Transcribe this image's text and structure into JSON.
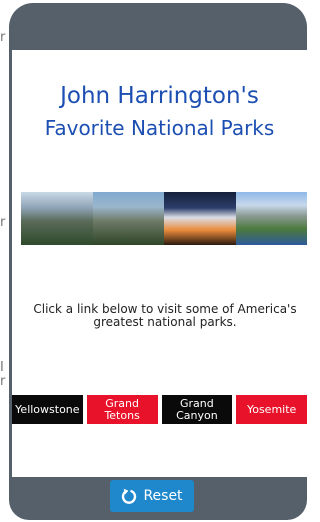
{
  "background_fragments": [
    "r",
    "r",
    "I",
    "r"
  ],
  "header": {
    "title_line1": "John Harrington's",
    "title_line2": "Favorite National Parks"
  },
  "intro_text": "Click a link below to visit some of America's greatest national parks.",
  "parks": [
    {
      "label": "Yellowstone",
      "color": "#0a0a0a"
    },
    {
      "label": "Grand Tetons",
      "color": "#e8132a"
    },
    {
      "label": "Grand Canyon",
      "color": "#0a0a0a"
    },
    {
      "label": "Yosemite",
      "color": "#e8132a"
    }
  ],
  "footer": {
    "reset_label": "Reset",
    "reset_icon": "refresh-icon"
  },
  "colors": {
    "title": "#1d4fb3",
    "device_frame": "#56606a",
    "reset_button": "#1f88cc"
  }
}
